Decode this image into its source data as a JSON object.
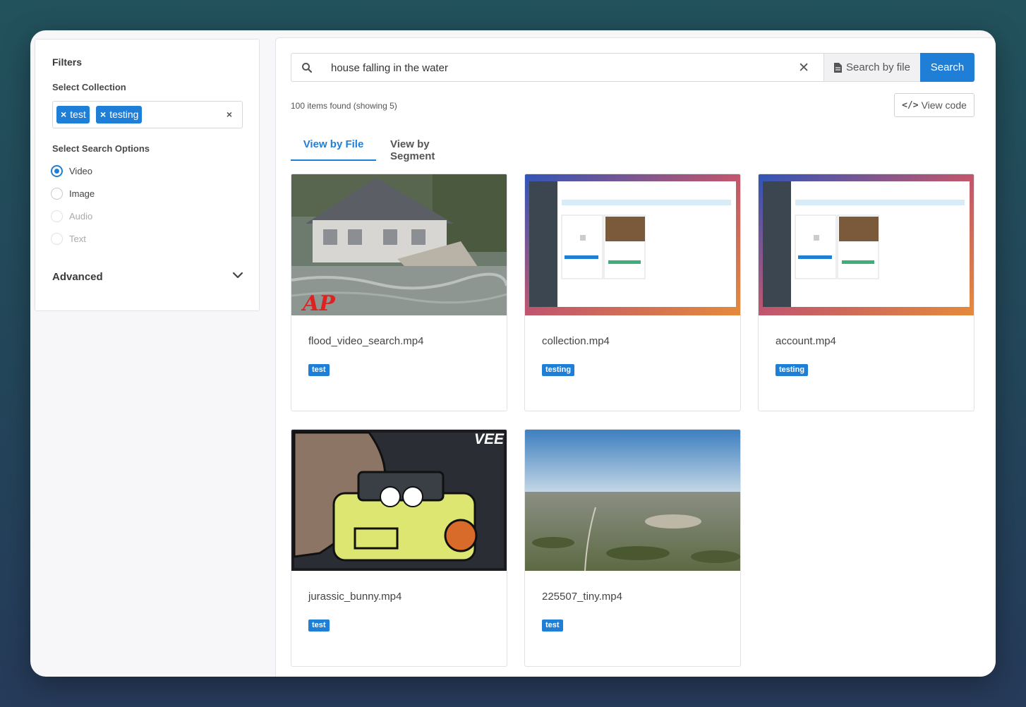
{
  "sidebar": {
    "title": "Filters",
    "collection_label": "Select Collection",
    "collection_chips": [
      "test",
      "testing"
    ],
    "chip_remove": "×",
    "clear_all": "×",
    "search_options_label": "Select Search Options",
    "options": [
      {
        "label": "Video",
        "checked": true,
        "disabled": false
      },
      {
        "label": "Image",
        "checked": false,
        "disabled": false
      },
      {
        "label": "Audio",
        "checked": false,
        "disabled": true
      },
      {
        "label": "Text",
        "checked": false,
        "disabled": true
      }
    ],
    "advanced_label": "Advanced"
  },
  "search": {
    "query": "house falling in the water",
    "clear": "✕",
    "search_by_file_label": "Search by file",
    "search_label": "Search"
  },
  "results": {
    "count_text": "100 items found (showing 5)",
    "view_code_label": "View code",
    "code_icon": "</>"
  },
  "tabs": [
    {
      "label": "View by File",
      "active": true
    },
    {
      "label": "View by Segment",
      "active": false
    }
  ],
  "cards": [
    {
      "title": "flood_video_search.mp4",
      "badge": "test",
      "thumb": "flood-house-thumbnail"
    },
    {
      "title": "collection.mp4",
      "badge": "testing",
      "thumb": "app-screenshot-thumbnail"
    },
    {
      "title": "account.mp4",
      "badge": "testing",
      "thumb": "app-screenshot-thumbnail"
    },
    {
      "title": "jurassic_bunny.mp4",
      "badge": "test",
      "thumb": "cartoon-jeep-thumbnail"
    },
    {
      "title": "225507_tiny.mp4",
      "badge": "test",
      "thumb": "aerial-landscape-thumbnail"
    }
  ],
  "thumb_overlay_text": {
    "ap_logo": "AP",
    "vee_logo": "VEE"
  },
  "colors": {
    "accent": "#1f7fd6",
    "background_top": "#22525c",
    "background_bottom": "#263a5a"
  }
}
